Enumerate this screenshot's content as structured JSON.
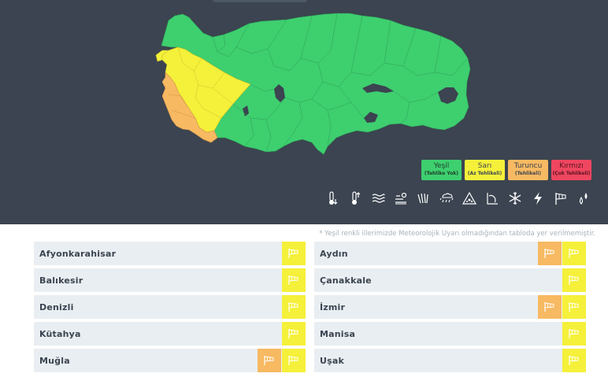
{
  "legend": [
    {
      "name": "Yeşil",
      "desc": "(Tehlike Yok)",
      "color": "#3ecf6f",
      "text_color": "#1f3d2a"
    },
    {
      "name": "Sarı",
      "desc": "(Az Tehlikeli)",
      "color": "#f5f03a",
      "text_color": "#3b4450"
    },
    {
      "name": "Turuncu",
      "desc": "(Tehlikeli)",
      "color": "#f7b962",
      "text_color": "#3b4450"
    },
    {
      "name": "Kırmızı",
      "desc": "(Çok Tehlikeli)",
      "color": "#ef4660",
      "text_color": "#5a1420"
    }
  ],
  "hazard_icons": [
    "thermometer-cold-icon",
    "thermometer-hot-icon",
    "fog-icon",
    "dust-icon",
    "rain-icon",
    "thunder-rain-icon",
    "avalanche-icon",
    "agriculture-frost-icon",
    "snow-icon",
    "lightning-icon",
    "wind-icon",
    "drizzle-icon"
  ],
  "note": "* Yeşil renkli illerimizde Meteorolojik Uyarı olmadığından tabloda yer verilmemiştir.",
  "left_provinces": [
    {
      "name": "Afyonkarahisar",
      "warnings": [
        "yellow"
      ]
    },
    {
      "name": "Balıkesir",
      "warnings": [
        "yellow"
      ]
    },
    {
      "name": "Denizli",
      "warnings": [
        "yellow"
      ]
    },
    {
      "name": "Kütahya",
      "warnings": [
        "yellow"
      ]
    },
    {
      "name": "Muğla",
      "warnings": [
        "orange",
        "yellow"
      ]
    }
  ],
  "right_provinces": [
    {
      "name": "Aydın",
      "warnings": [
        "orange",
        "yellow"
      ]
    },
    {
      "name": "Çanakkale",
      "warnings": [
        "yellow"
      ]
    },
    {
      "name": "İzmir",
      "warnings": [
        "orange",
        "yellow"
      ]
    },
    {
      "name": "Manisa",
      "warnings": [
        "yellow"
      ]
    },
    {
      "name": "Uşak",
      "warnings": [
        "yellow"
      ]
    }
  ],
  "colors": {
    "yellow": "#f5f03a",
    "orange": "#f7b962",
    "green": "#3ecf6f",
    "background": "#3b4450"
  }
}
